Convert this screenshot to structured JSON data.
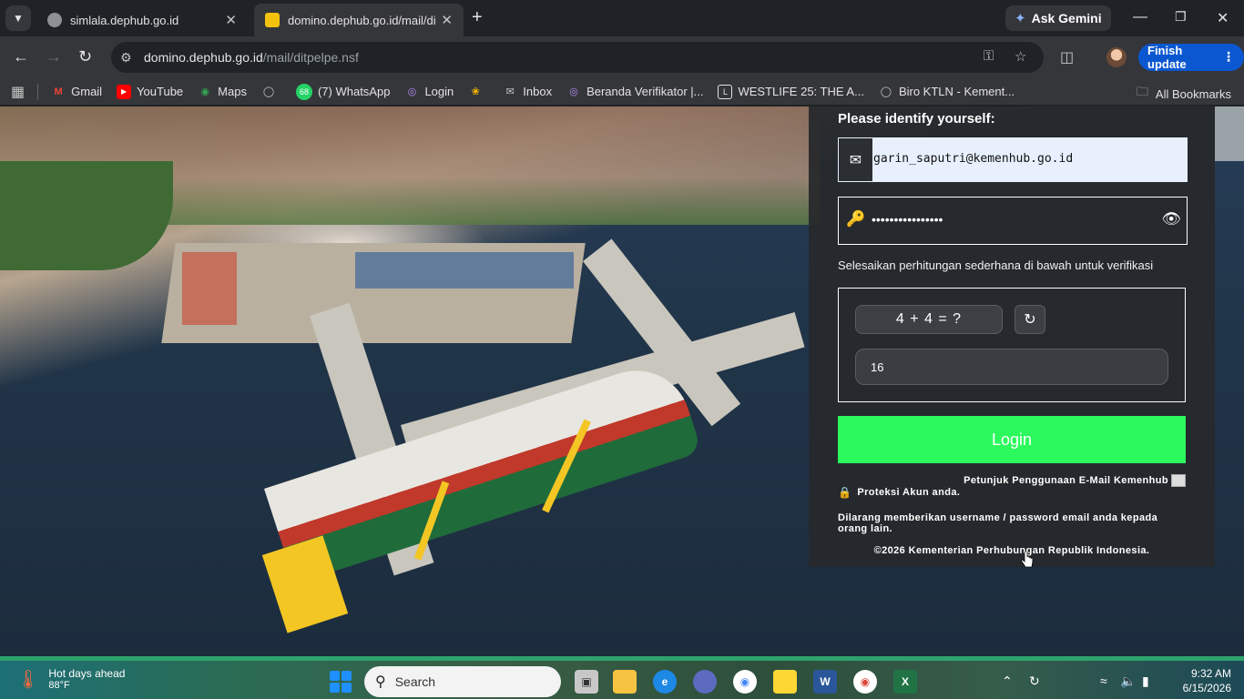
{
  "browser": {
    "tabs": [
      {
        "title": "simlala.dephub.go.id",
        "active": false
      },
      {
        "title": "domino.dephub.go.id/mail/ditp",
        "active": true
      }
    ],
    "gemini_label": "Ask Gemini",
    "url_host": "domino.dephub.go.id",
    "url_path": "/mail/ditpelpe.nsf",
    "finish_update_label": "Finish update",
    "bookmarks": [
      {
        "label": "Gmail",
        "icon": "gmail-icon"
      },
      {
        "label": "YouTube",
        "icon": "youtube-icon"
      },
      {
        "label": "Maps",
        "icon": "maps-icon"
      },
      {
        "label": "",
        "icon": "globe-icon"
      },
      {
        "label": "(7) WhatsApp",
        "badge": "68",
        "icon": "whatsapp-icon"
      },
      {
        "label": "Login",
        "icon": "login-site-icon"
      },
      {
        "label": "",
        "icon": "pinwheel-icon"
      },
      {
        "label": "Inbox",
        "icon": "mail-icon"
      },
      {
        "label": "Beranda Verifikator |...",
        "icon": "site-icon"
      },
      {
        "label": "WESTLIFE 25: THE A...",
        "icon": "site-icon"
      },
      {
        "label": "Biro KTLN - Kement...",
        "icon": "globe-icon"
      }
    ],
    "all_bookmarks_label": "All Bookmarks"
  },
  "login": {
    "identify_label": "Please identify yourself:",
    "email_value": "garin_saputri@kemenhub.go.id",
    "password_mask": "••••••••••••••••",
    "verify_hint": "Selesaikan perhitungan sederhana di bawah untuk verifikasi",
    "captcha_question": "4 + 4 = ?",
    "captcha_answer": "16",
    "login_button": "Login",
    "guide_link": "Petunjuk Penggunaan E-Mail Kemenhub",
    "protect_text": "Proteksi Akun anda.",
    "warning_text": "Dilarang memberikan username / password email anda kepada orang lain.",
    "copyright": "©2026 Kementerian Perhubungan Republik Indonesia."
  },
  "taskbar": {
    "weather_title": "Hot days ahead",
    "weather_temp": "88°F",
    "search_placeholder": "Search",
    "time": "9:32 AM",
    "date": "6/15/2026"
  },
  "colors": {
    "login_button": "#2bf95c",
    "panel_bg": "#26282c",
    "accent_blue": "#0b57d0"
  }
}
